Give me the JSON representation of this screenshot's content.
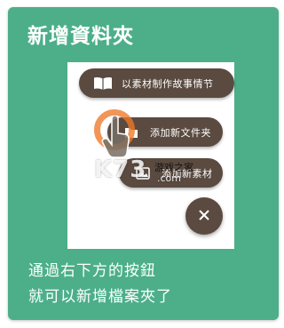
{
  "card": {
    "title": "新增資料夾",
    "background_color": "#4caf8a"
  },
  "preview": {
    "menu_items": [
      {
        "label": "以素材制作故事情节",
        "icon": "book-icon"
      },
      {
        "label": "添加新文件夹",
        "icon": "folder-icon"
      },
      {
        "label": "添加新素材",
        "icon": "material-icon"
      }
    ],
    "fab_icon": "close-icon",
    "button_color": "#5a4a40",
    "touch_indicator_color": "#ee7828",
    "watermark": {
      "logo": "K73",
      "site_name": "游戏之家",
      "domain": ".com"
    }
  },
  "description": {
    "line1": "通過右下方的按鈕",
    "line2": "就可以新增檔案夾了"
  }
}
